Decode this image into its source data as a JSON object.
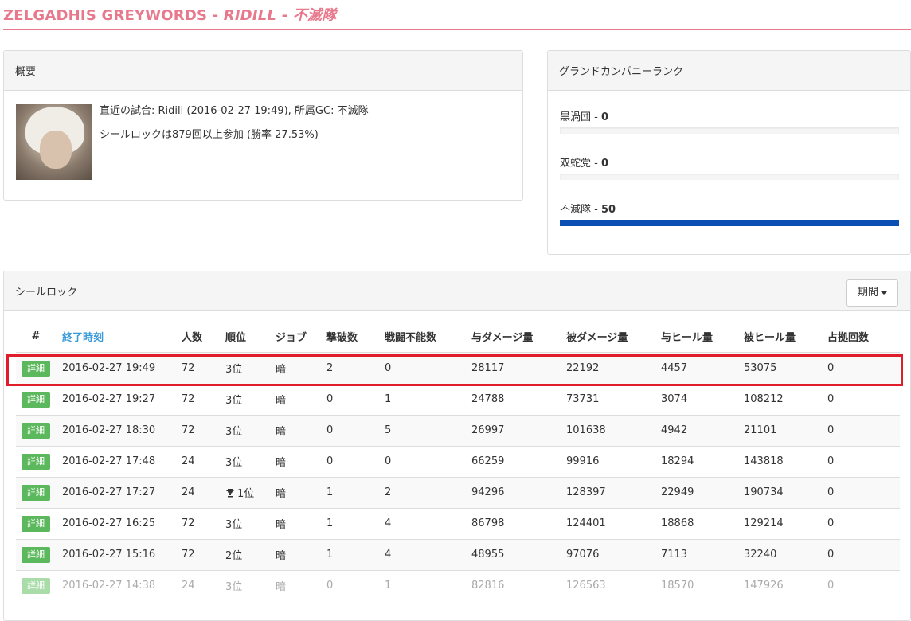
{
  "header": {
    "character_name": "ZELGADHIS GREYWORDS",
    "separator": "-",
    "world": "RIDILL",
    "grand_company": "不滅隊"
  },
  "overview": {
    "title": "概要",
    "last_match": "直近の試合: Ridill (2016-02-27 19:49), 所属GC: 不滅隊",
    "participation": "シールロックは879回以上参加 (勝率 27.53%)"
  },
  "gc_rank": {
    "title": "グランドカンパニーランク",
    "items": [
      {
        "name": "黒渦団",
        "value": "0",
        "fill": 0
      },
      {
        "name": "双蛇党",
        "value": "0",
        "fill": 0
      },
      {
        "name": "不滅隊",
        "value": "50",
        "fill": 1.0
      }
    ],
    "bar_color": "#0b4fb5"
  },
  "sealrock": {
    "title": "シールロック",
    "period_label": "期間",
    "columns": [
      "#",
      "終了時刻",
      "人数",
      "順位",
      "ジョブ",
      "撃破数",
      "戦闘不能数",
      "与ダメージ量",
      "被ダメージ量",
      "与ヒール量",
      "被ヒール量",
      "占拠回数"
    ],
    "detail_label": "詳細",
    "rows": [
      {
        "time": "2016-02-27 19:49",
        "players": "72",
        "rank": "3位",
        "trophy": false,
        "job": "暗",
        "kills": "2",
        "deaths": "0",
        "dmg_dealt": "28117",
        "dmg_taken": "22192",
        "heal_dealt": "4457",
        "heal_taken": "53075",
        "captures": "0"
      },
      {
        "time": "2016-02-27 19:27",
        "players": "72",
        "rank": "3位",
        "trophy": false,
        "job": "暗",
        "kills": "0",
        "deaths": "1",
        "dmg_dealt": "24788",
        "dmg_taken": "73731",
        "heal_dealt": "3074",
        "heal_taken": "108212",
        "captures": "0"
      },
      {
        "time": "2016-02-27 18:30",
        "players": "72",
        "rank": "3位",
        "trophy": false,
        "job": "暗",
        "kills": "0",
        "deaths": "5",
        "dmg_dealt": "26997",
        "dmg_taken": "101638",
        "heal_dealt": "4942",
        "heal_taken": "21101",
        "captures": "0"
      },
      {
        "time": "2016-02-27 17:48",
        "players": "24",
        "rank": "3位",
        "trophy": false,
        "job": "暗",
        "kills": "0",
        "deaths": "0",
        "dmg_dealt": "66259",
        "dmg_taken": "99916",
        "heal_dealt": "18294",
        "heal_taken": "143818",
        "captures": "0"
      },
      {
        "time": "2016-02-27 17:27",
        "players": "24",
        "rank": "1位",
        "trophy": true,
        "job": "暗",
        "kills": "1",
        "deaths": "2",
        "dmg_dealt": "94296",
        "dmg_taken": "128397",
        "heal_dealt": "22949",
        "heal_taken": "190734",
        "captures": "0"
      },
      {
        "time": "2016-02-27 16:25",
        "players": "72",
        "rank": "3位",
        "trophy": false,
        "job": "暗",
        "kills": "1",
        "deaths": "4",
        "dmg_dealt": "86798",
        "dmg_taken": "124401",
        "heal_dealt": "18868",
        "heal_taken": "129214",
        "captures": "0"
      },
      {
        "time": "2016-02-27 15:16",
        "players": "72",
        "rank": "2位",
        "trophy": false,
        "job": "暗",
        "kills": "1",
        "deaths": "4",
        "dmg_dealt": "48955",
        "dmg_taken": "97076",
        "heal_dealt": "7113",
        "heal_taken": "32240",
        "captures": "0"
      },
      {
        "time": "2016-02-27 14:38",
        "players": "24",
        "rank": "3位",
        "trophy": false,
        "job": "暗",
        "kills": "0",
        "deaths": "1",
        "dmg_dealt": "82816",
        "dmg_taken": "126563",
        "heal_dealt": "18570",
        "heal_taken": "147926",
        "captures": "0"
      }
    ]
  }
}
